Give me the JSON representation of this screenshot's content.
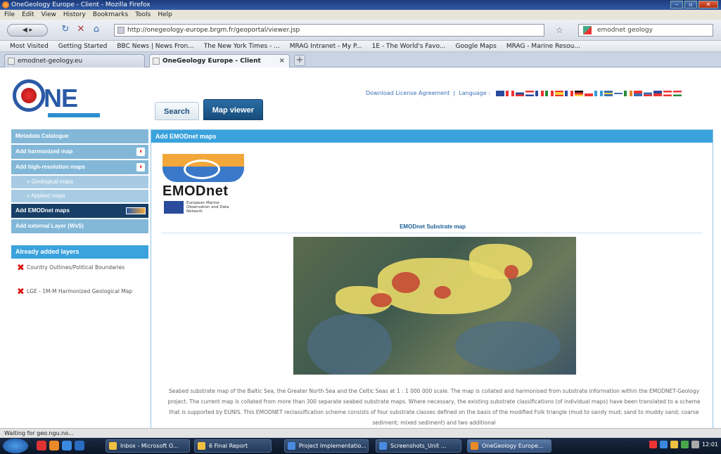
{
  "browser": {
    "window_title": "OneGeology Europe - Client - Mozilla Firefox",
    "menu": [
      "File",
      "Edit",
      "View",
      "History",
      "Bookmarks",
      "Tools",
      "Help"
    ],
    "back_label": "",
    "url": "http://onegeology-europe.brgm.fr/geoportal/viewer.jsp",
    "search_value": "emodnet geology",
    "bookmarks": [
      "Most Visited",
      "Getting Started",
      "BBC News | News Fron...",
      "The New York Times - ...",
      "MRAG Intranet - My P...",
      "1E - The World's Favo...",
      "Google Maps",
      "MRAG - Marine Resou..."
    ],
    "tabs": [
      {
        "label": "emodnet-geology.eu"
      },
      {
        "label": "OneGeology Europe - Client"
      }
    ],
    "status": "Waiting for geo.ngu.no..."
  },
  "page": {
    "logo_text": "NE",
    "download_license": "Download License Agreement",
    "language_label": "Language :",
    "tabs": {
      "search": "Search",
      "map_viewer": "Map viewer"
    },
    "sidebar": [
      {
        "label": "Metadata Catalogue"
      },
      {
        "label": "Add harmonized map"
      },
      {
        "label": "Add high-resolution maps"
      },
      {
        "label": "» Geological maps"
      },
      {
        "label": "» Applied maps"
      },
      {
        "label": "Add EMODnet maps"
      },
      {
        "label": "Add external Layer (WxS)"
      }
    ],
    "already_added": {
      "header": "Already added layers",
      "layers": [
        {
          "label": "Country Outlines/Political Boundaries"
        },
        {
          "label": "LGE - 1M-M Harmonized Geological Map"
        }
      ]
    },
    "main": {
      "header": "Add EMODnet maps",
      "emodnet_word": "EMODnet",
      "emodnet_tagline": "European Marine Observation and Data Network",
      "map_title": "EMODnet Substrate map",
      "description": "Seabed substrate map of the Baltic Sea, the Greater North Sea and the Celtic Seas at 1 : 1 000 000 scale. The map is collated and harmonised from substrate information within the EMODNET-Geology project. The current map is collated from more than 300 separate seabed substrate maps. Where necessary, the existing substrate classifications (of individual maps) have been translated to a scheme that is supported by EUNIS. This EMODNET reclassification scheme consists of four substrate classes defined on the basis of the modified Folk triangle (mud to sandy mud; sand to muddy sand; coarse sediment; mixed sediment) and two additional"
    }
  },
  "taskbar": {
    "items": [
      {
        "label": "Inbox - Microsoft O..."
      },
      {
        "label": "6 Final Report"
      },
      {
        "label": "Project Implementatio..."
      },
      {
        "label": "Screenshots_Unit ..."
      },
      {
        "label": "OneGeology Europe..."
      }
    ],
    "clock": "12:01"
  },
  "colors": {
    "accent": "#3aa2dc",
    "sidebar_active": "#173e66",
    "map_tab": "#174c7c"
  }
}
